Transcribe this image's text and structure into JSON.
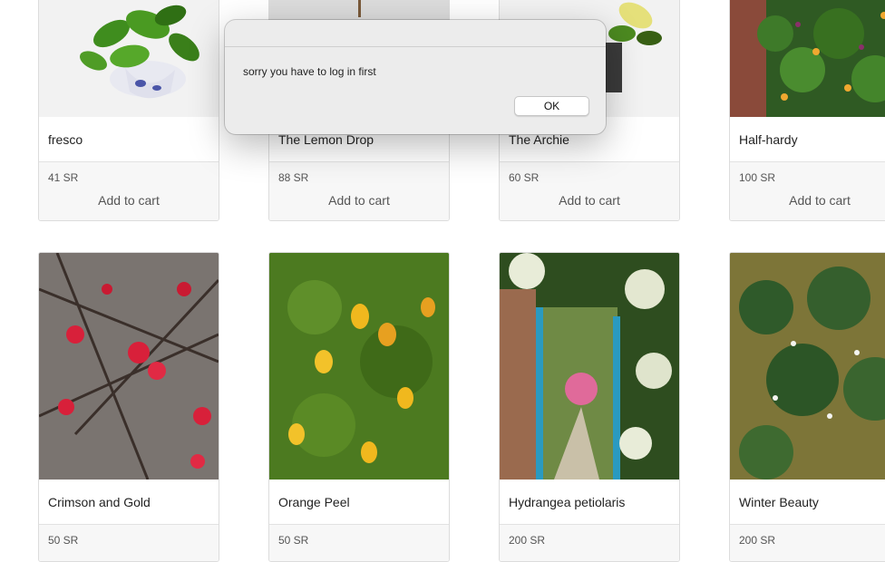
{
  "dialog": {
    "message": "sorry you have to log in first",
    "ok_label": "OK"
  },
  "products_row1": [
    {
      "name": "fresco",
      "price": "41 SR",
      "cart": "Add to cart"
    },
    {
      "name": "The Lemon Drop",
      "price": "88 SR",
      "cart": "Add to cart"
    },
    {
      "name": "The Archie",
      "price": "60 SR",
      "cart": "Add to cart"
    },
    {
      "name": "Half-hardy",
      "price": "100 SR",
      "cart": "Add to cart"
    }
  ],
  "products_row2": [
    {
      "name": "Crimson and Gold",
      "price": "50 SR"
    },
    {
      "name": "Orange Peel",
      "price": "50 SR"
    },
    {
      "name": "Hydrangea petiolaris",
      "price": "200 SR"
    },
    {
      "name": "Winter Beauty",
      "price": "200 SR"
    }
  ]
}
